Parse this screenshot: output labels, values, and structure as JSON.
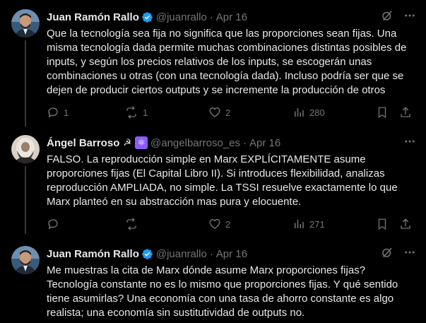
{
  "tweets": [
    {
      "name": "Juan Ramón Rallo",
      "handle": "@juanrallo",
      "date": "Apr 16",
      "verified": true,
      "text": "Que la tecnología sea fija no significa que las proporciones sean fijas. Una misma tecnología dada permite muchas combinaciones distintas posibles de inputs, y según los precios relativos de los inputs, se escogerán unas combinaciones u otras (con una tecnología dada). Incluso podría ser que se dejen de producir ciertos outputs y se incremente la producción de otros",
      "replies": "1",
      "retweets": "1",
      "likes": "2",
      "views": "280"
    },
    {
      "name": "Ángel Barroso",
      "emoji": "☭ ⚛",
      "handle": "@angelbarroso_es",
      "date": "Apr 16",
      "verified": false,
      "text": "FALSO. La reproducción simple en Marx EXPLÍCITAMENTE asume proporciones fijas (El Capital Libro II). Si introduces flexibilidad, analizas reproducción AMPLIADA, no simple. La TSSI resuelve exactamente lo que Marx planteó en su abstracción mas pura y elocuente.",
      "replies": "",
      "retweets": "",
      "likes": "2",
      "views": "271"
    },
    {
      "name": "Juan Ramón Rallo",
      "handle": "@juanrallo",
      "date": "Apr 16",
      "verified": true,
      "text": "Me muestras la cita de Marx dónde asume Marx proporciones fijas? Tecnología constante no es lo mismo que proporciones fijas. Y qué sentido tiene asumirlas? Una economía con una tasa de ahorro constante es algo realista; una economía sin sustitutividad de outputs no."
    }
  ],
  "colors": {
    "background": "#000000",
    "text": "#e7e9ea",
    "muted": "#71767b",
    "verified": "#1d9bf0",
    "divider": "#2f3336"
  }
}
